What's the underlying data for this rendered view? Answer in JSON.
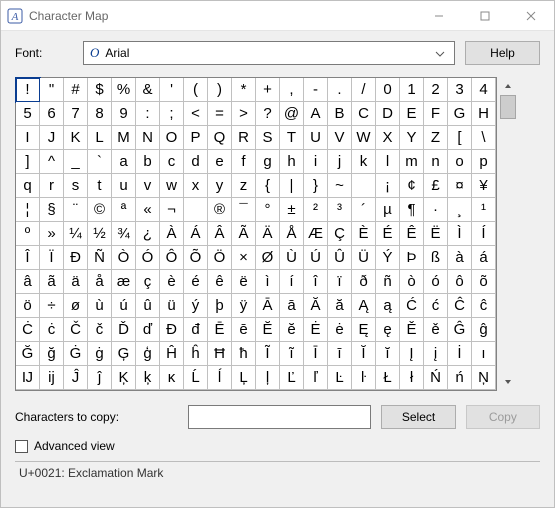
{
  "window": {
    "title": "Character Map"
  },
  "labels": {
    "font": "Font:",
    "help": "Help",
    "chars_to_copy": "Characters to copy:",
    "select": "Select",
    "copy": "Copy",
    "advanced_view": "Advanced view"
  },
  "font": {
    "name": "Arial",
    "icon_glyph": "O"
  },
  "copy_field": {
    "value": ""
  },
  "advanced_view_checked": false,
  "status": "U+0021: Exclamation Mark",
  "selected_index": 0,
  "grid_chars": [
    "!",
    "\"",
    "#",
    "$",
    "%",
    "&",
    "'",
    "(",
    ")",
    "*",
    "+",
    ",",
    "-",
    ".",
    "/",
    "0",
    "1",
    "2",
    "3",
    "4",
    "5",
    "6",
    "7",
    "8",
    "9",
    ":",
    ";",
    "<",
    "=",
    ">",
    "?",
    "@",
    "A",
    "B",
    "C",
    "D",
    "E",
    "F",
    "G",
    "H",
    "I",
    "J",
    "K",
    "L",
    "M",
    "N",
    "O",
    "P",
    "Q",
    "R",
    "S",
    "T",
    "U",
    "V",
    "W",
    "X",
    "Y",
    "Z",
    "[",
    "\\",
    "]",
    "^",
    "_",
    "`",
    "a",
    "b",
    "c",
    "d",
    "e",
    "f",
    "g",
    "h",
    "i",
    "j",
    "k",
    "l",
    "m",
    "n",
    "o",
    "p",
    "q",
    "r",
    "s",
    "t",
    "u",
    "v",
    "w",
    "x",
    "y",
    "z",
    "{",
    "|",
    "}",
    "~",
    "",
    "¡",
    "¢",
    "£",
    "¤",
    "¥",
    "¦",
    "§",
    "¨",
    "©",
    "ª",
    "«",
    "¬",
    "­",
    "®",
    "¯",
    "°",
    "±",
    "²",
    "³",
    "´",
    "µ",
    "¶",
    "·",
    "¸",
    "¹",
    "º",
    "»",
    "¼",
    "½",
    "¾",
    "¿",
    "À",
    "Á",
    "Â",
    "Ã",
    "Ä",
    "Å",
    "Æ",
    "Ç",
    "È",
    "É",
    "Ê",
    "Ë",
    "Ì",
    "Í",
    "Î",
    "Ï",
    "Ð",
    "Ñ",
    "Ò",
    "Ó",
    "Ô",
    "Õ",
    "Ö",
    "×",
    "Ø",
    "Ù",
    "Ú",
    "Û",
    "Ü",
    "Ý",
    "Þ",
    "ß",
    "à",
    "á",
    "â",
    "ã",
    "ä",
    "å",
    "æ",
    "ç",
    "è",
    "é",
    "ê",
    "ë",
    "ì",
    "í",
    "î",
    "ï",
    "ð",
    "ñ",
    "ò",
    "ó",
    "ô",
    "õ",
    "ö",
    "÷",
    "ø",
    "ù",
    "ú",
    "û",
    "ü",
    "ý",
    "þ",
    "ÿ",
    "Ā",
    "ā",
    "Ă",
    "ă",
    "Ą",
    "ą",
    "Ć",
    "ć",
    "Ĉ",
    "ĉ",
    "Ċ",
    "ċ",
    "Č",
    "č",
    "Ď",
    "ď",
    "Đ",
    "đ",
    "Ē",
    "ē",
    "Ĕ",
    "ĕ",
    "Ė",
    "ė",
    "Ę",
    "ę",
    "Ě",
    "ě",
    "Ĝ",
    "ĝ",
    "Ğ",
    "ğ",
    "Ġ",
    "ġ",
    "Ģ",
    "ģ",
    "Ĥ",
    "ĥ",
    "Ħ",
    "ħ",
    "Ĩ",
    "ĩ",
    "Ī",
    "ī",
    "Ĭ",
    "ĭ",
    "Į",
    "į",
    "İ",
    "ı",
    "Ĳ",
    "ĳ",
    "Ĵ",
    "ĵ",
    "Ķ",
    "ķ",
    "ĸ",
    "Ĺ",
    "ĺ",
    "Ļ",
    "ļ",
    "Ľ",
    "ľ",
    "Ŀ",
    "ŀ",
    "Ł",
    "ł",
    "Ń",
    "ń",
    "Ņ"
  ]
}
